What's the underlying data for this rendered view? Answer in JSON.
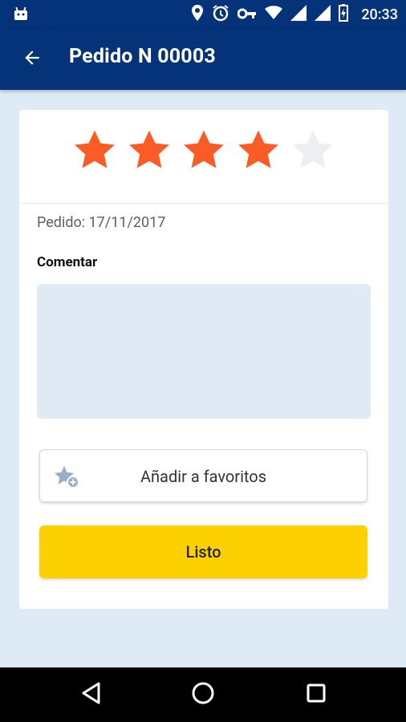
{
  "status_bar": {
    "time": "20:33",
    "icons": [
      "android-icon",
      "location-icon",
      "alarm-icon",
      "vpn-key-icon",
      "wifi-icon",
      "signal-icon",
      "signal-icon",
      "battery-charging-icon"
    ]
  },
  "app_bar": {
    "title": "Pedido N 00003",
    "back_icon": "arrow-back-icon"
  },
  "rating": {
    "value": 4,
    "max": 5,
    "active_color": "#fb5b24",
    "inactive_color": "#eceff2"
  },
  "order": {
    "date_text": "Pedido: 17/11/2017"
  },
  "comment": {
    "label": "Comentar",
    "value": ""
  },
  "favorites_button": {
    "label": "Añadir a favoritos",
    "icon": "star-add-icon"
  },
  "done_button": {
    "label": "Listo"
  },
  "colors": {
    "primary": "#04337a",
    "accent": "#fdd100",
    "background": "#deeaf5"
  },
  "nav_bar": {
    "icons": [
      "back-triangle-icon",
      "home-circle-icon",
      "recents-square-icon"
    ]
  }
}
